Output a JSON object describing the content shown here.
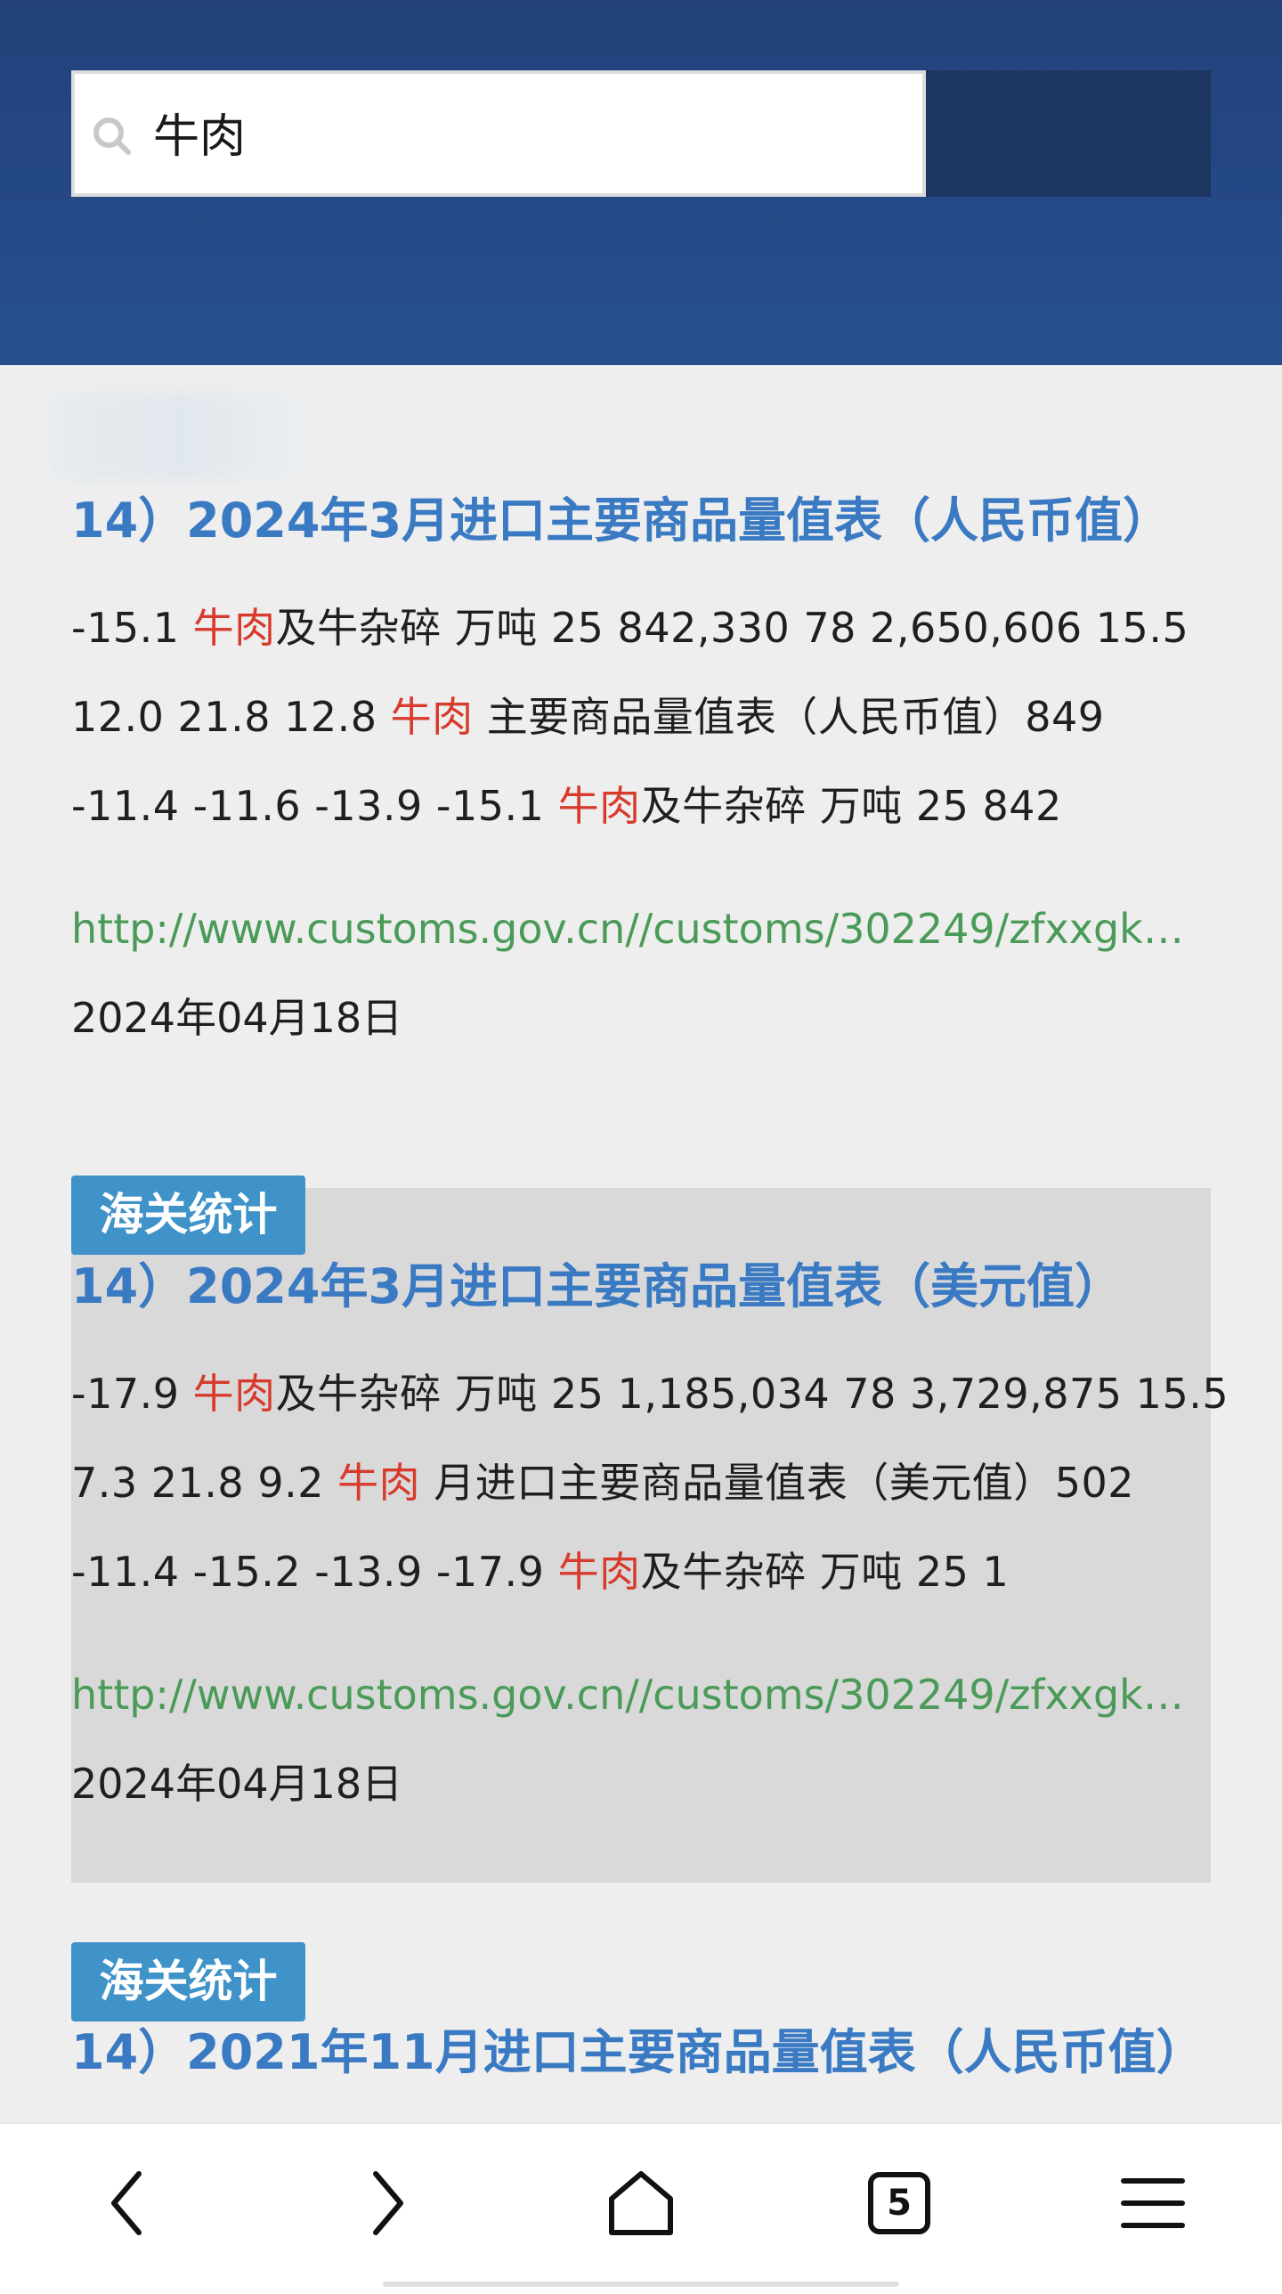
{
  "search": {
    "query": "牛肉"
  },
  "results": [
    {
      "tag": "",
      "title": "14）2024年3月进口主要商品量值表（人民币值）",
      "lines": [
        [
          {
            "t": "-15.1 "
          },
          {
            "t": "牛肉",
            "h": true
          },
          {
            "t": "及牛杂碎  万吨  25  842,330  78  2,650,606  15.5"
          }
        ],
        [
          {
            "t": "12.0  21.8  12.8  "
          },
          {
            "t": "牛肉",
            "h": true
          },
          {
            "t": "  主要商品量值表（人民币值）849"
          }
        ],
        [
          {
            "t": "-11.4  -11.6  -13.9  -15.1  "
          },
          {
            "t": "牛肉",
            "h": true
          },
          {
            "t": "及牛杂碎  万吨  25  842"
          }
        ]
      ],
      "url": "http://www.customs.gov.cn//customs/302249/zfxxgk…",
      "date": "2024年04月18日"
    },
    {
      "tag": "海关统计",
      "title": "14）2024年3月进口主要商品量值表（美元值）",
      "lines": [
        [
          {
            "t": "-17.9 "
          },
          {
            "t": "牛肉",
            "h": true
          },
          {
            "t": "及牛杂碎  万吨  25  1,185,034  78  3,729,875  15.5"
          }
        ],
        [
          {
            "t": "7.3  21.8  9.2  "
          },
          {
            "t": "牛肉",
            "h": true
          },
          {
            "t": "  月进口主要商品量值表（美元值）502"
          }
        ],
        [
          {
            "t": "-11.4  -15.2  -13.9  -17.9  "
          },
          {
            "t": "牛肉",
            "h": true
          },
          {
            "t": "及牛杂碎  万吨  25  1"
          }
        ]
      ],
      "url": "http://www.customs.gov.cn//customs/302249/zfxxgk…",
      "date": "2024年04月18日"
    },
    {
      "tag": "海关统计",
      "title": "14）2021年11月进口主要商品量值表（人民币值）"
    }
  ],
  "nav": {
    "tab_count": "5",
    "icons": [
      "back-icon",
      "forward-icon",
      "home-icon",
      "tabs-icon",
      "menu-icon"
    ]
  },
  "colors": {
    "header": "#274f8f",
    "title": "#3a7ac3",
    "highlight": "#d83a2c",
    "url": "#4a9a58",
    "tag": "#3f93c9"
  }
}
